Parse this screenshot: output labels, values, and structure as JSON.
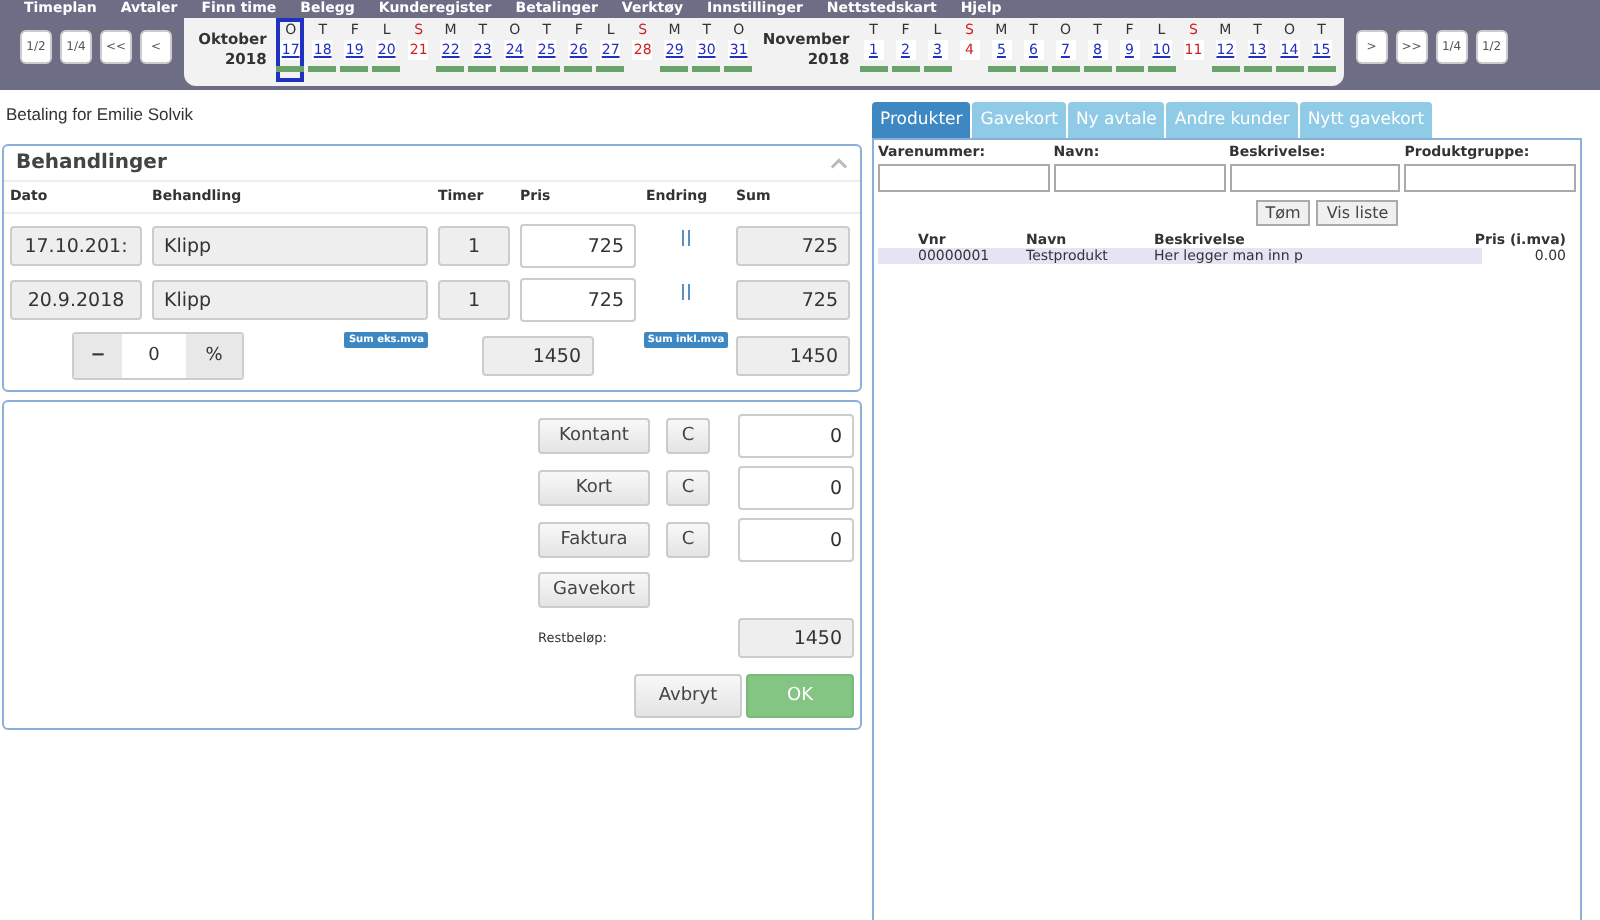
{
  "menu": [
    "Timeplan",
    "Avtaler",
    "Finn time",
    "Belegg",
    "Kunderegister",
    "Betalinger",
    "Verktøy",
    "Innstillinger",
    "Nettstedskart",
    "Hjelp"
  ],
  "nav_left": [
    "1/2",
    "1/4",
    "<<",
    "<"
  ],
  "nav_right": [
    ">",
    ">>",
    "1/4",
    "1/2"
  ],
  "months": [
    {
      "name": "Oktober",
      "year": "2018",
      "days": [
        {
          "letter": "O",
          "date": "17",
          "sunday": false,
          "booked": true,
          "selected": true
        },
        {
          "letter": "T",
          "date": "18",
          "sunday": false,
          "booked": true,
          "selected": false
        },
        {
          "letter": "F",
          "date": "19",
          "sunday": false,
          "booked": true,
          "selected": false
        },
        {
          "letter": "L",
          "date": "20",
          "sunday": false,
          "booked": true,
          "selected": false
        },
        {
          "letter": "S",
          "date": "21",
          "sunday": true,
          "booked": false,
          "selected": false
        },
        {
          "letter": "M",
          "date": "22",
          "sunday": false,
          "booked": true,
          "selected": false
        },
        {
          "letter": "T",
          "date": "23",
          "sunday": false,
          "booked": true,
          "selected": false
        },
        {
          "letter": "O",
          "date": "24",
          "sunday": false,
          "booked": true,
          "selected": false
        },
        {
          "letter": "T",
          "date": "25",
          "sunday": false,
          "booked": true,
          "selected": false
        },
        {
          "letter": "F",
          "date": "26",
          "sunday": false,
          "booked": true,
          "selected": false
        },
        {
          "letter": "L",
          "date": "27",
          "sunday": false,
          "booked": true,
          "selected": false
        },
        {
          "letter": "S",
          "date": "28",
          "sunday": true,
          "booked": false,
          "selected": false
        },
        {
          "letter": "M",
          "date": "29",
          "sunday": false,
          "booked": true,
          "selected": false
        },
        {
          "letter": "T",
          "date": "30",
          "sunday": false,
          "booked": true,
          "selected": false
        },
        {
          "letter": "O",
          "date": "31",
          "sunday": false,
          "booked": true,
          "selected": false
        }
      ]
    },
    {
      "name": "November",
      "year": "2018",
      "days": [
        {
          "letter": "T",
          "date": "1",
          "sunday": false,
          "booked": true,
          "selected": false
        },
        {
          "letter": "F",
          "date": "2",
          "sunday": false,
          "booked": true,
          "selected": false
        },
        {
          "letter": "L",
          "date": "3",
          "sunday": false,
          "booked": true,
          "selected": false
        },
        {
          "letter": "S",
          "date": "4",
          "sunday": true,
          "booked": false,
          "selected": false
        },
        {
          "letter": "M",
          "date": "5",
          "sunday": false,
          "booked": true,
          "selected": false
        },
        {
          "letter": "T",
          "date": "6",
          "sunday": false,
          "booked": true,
          "selected": false
        },
        {
          "letter": "O",
          "date": "7",
          "sunday": false,
          "booked": true,
          "selected": false
        },
        {
          "letter": "T",
          "date": "8",
          "sunday": false,
          "booked": true,
          "selected": false
        },
        {
          "letter": "F",
          "date": "9",
          "sunday": false,
          "booked": true,
          "selected": false
        },
        {
          "letter": "L",
          "date": "10",
          "sunday": false,
          "booked": true,
          "selected": false
        },
        {
          "letter": "S",
          "date": "11",
          "sunday": true,
          "booked": false,
          "selected": false
        },
        {
          "letter": "M",
          "date": "12",
          "sunday": false,
          "booked": true,
          "selected": false
        },
        {
          "letter": "T",
          "date": "13",
          "sunday": false,
          "booked": true,
          "selected": false
        },
        {
          "letter": "O",
          "date": "14",
          "sunday": false,
          "booked": true,
          "selected": false
        },
        {
          "letter": "T",
          "date": "15",
          "sunday": false,
          "booked": true,
          "selected": false
        }
      ]
    }
  ],
  "payment_title": "Betaling for Emilie Solvik",
  "treatments": {
    "title": "Behandlinger",
    "columns": [
      "Dato",
      "Behandling",
      "Timer",
      "Pris",
      "Endring",
      "Sum"
    ],
    "rows": [
      {
        "date": "17.10.201:",
        "treatment": "Klipp",
        "hours": "1",
        "price": "725",
        "sum": "725"
      },
      {
        "date": "20.9.2018",
        "treatment": "Klipp",
        "hours": "1",
        "price": "725",
        "sum": "725"
      }
    ],
    "discount_minus": "−",
    "discount": "0",
    "discount_unit": "%",
    "sum_ex_label": "Sum eks.mva",
    "sum_ex": "1450",
    "sum_inc_label": "Sum inkl.mva",
    "sum_inc": "1450"
  },
  "payments": [
    {
      "label": "Kontant",
      "clear": "C",
      "amount": "0"
    },
    {
      "label": "Kort",
      "clear": "C",
      "amount": "0"
    },
    {
      "label": "Faktura",
      "clear": "C",
      "amount": "0"
    }
  ],
  "giftcard_button": "Gavekort",
  "remaining_label": "Restbeløp:",
  "remaining": "1450",
  "cancel": "Avbryt",
  "ok": "OK",
  "tabs": [
    {
      "label": "Produkter",
      "selected": true
    },
    {
      "label": "Gavekort",
      "selected": false
    },
    {
      "label": "Ny avtale",
      "selected": false
    },
    {
      "label": "Andre kunder",
      "selected": false
    },
    {
      "label": "Nytt gavekort",
      "selected": false
    }
  ],
  "filters": [
    "Varenummer:",
    "Navn:",
    "Beskrivelse:",
    "Produktgruppe:"
  ],
  "clear_button": "Tøm",
  "list_button": "Vis liste",
  "products": {
    "columns": [
      "Vnr",
      "Navn",
      "Beskrivelse",
      "Pris (i.mva)"
    ],
    "rows": [
      [
        "00000001",
        "Testprodukt",
        "Her legger man inn p",
        "0.00"
      ]
    ]
  }
}
